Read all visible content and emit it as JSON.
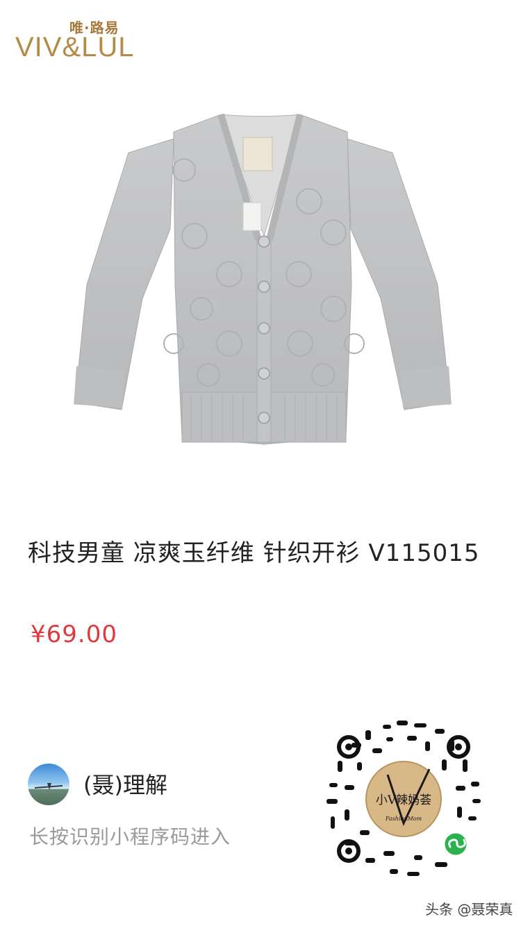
{
  "brand": {
    "cn": "唯·路易",
    "en": "VIV&LUL"
  },
  "product": {
    "title": "科技男童 凉爽玉纤维 针织开衫 V115015",
    "price": "¥69.00"
  },
  "share": {
    "username": "(聂)理解",
    "hint": "长按识别小程序码进入"
  },
  "qr": {
    "center_text": "小V辣妈荟",
    "center_subtext": "FashionMom"
  },
  "watermark": "头条 @聂荣真",
  "colors": {
    "price": "#e0393c",
    "brand": "#b58a47",
    "wechat_green": "#2bb24c"
  }
}
